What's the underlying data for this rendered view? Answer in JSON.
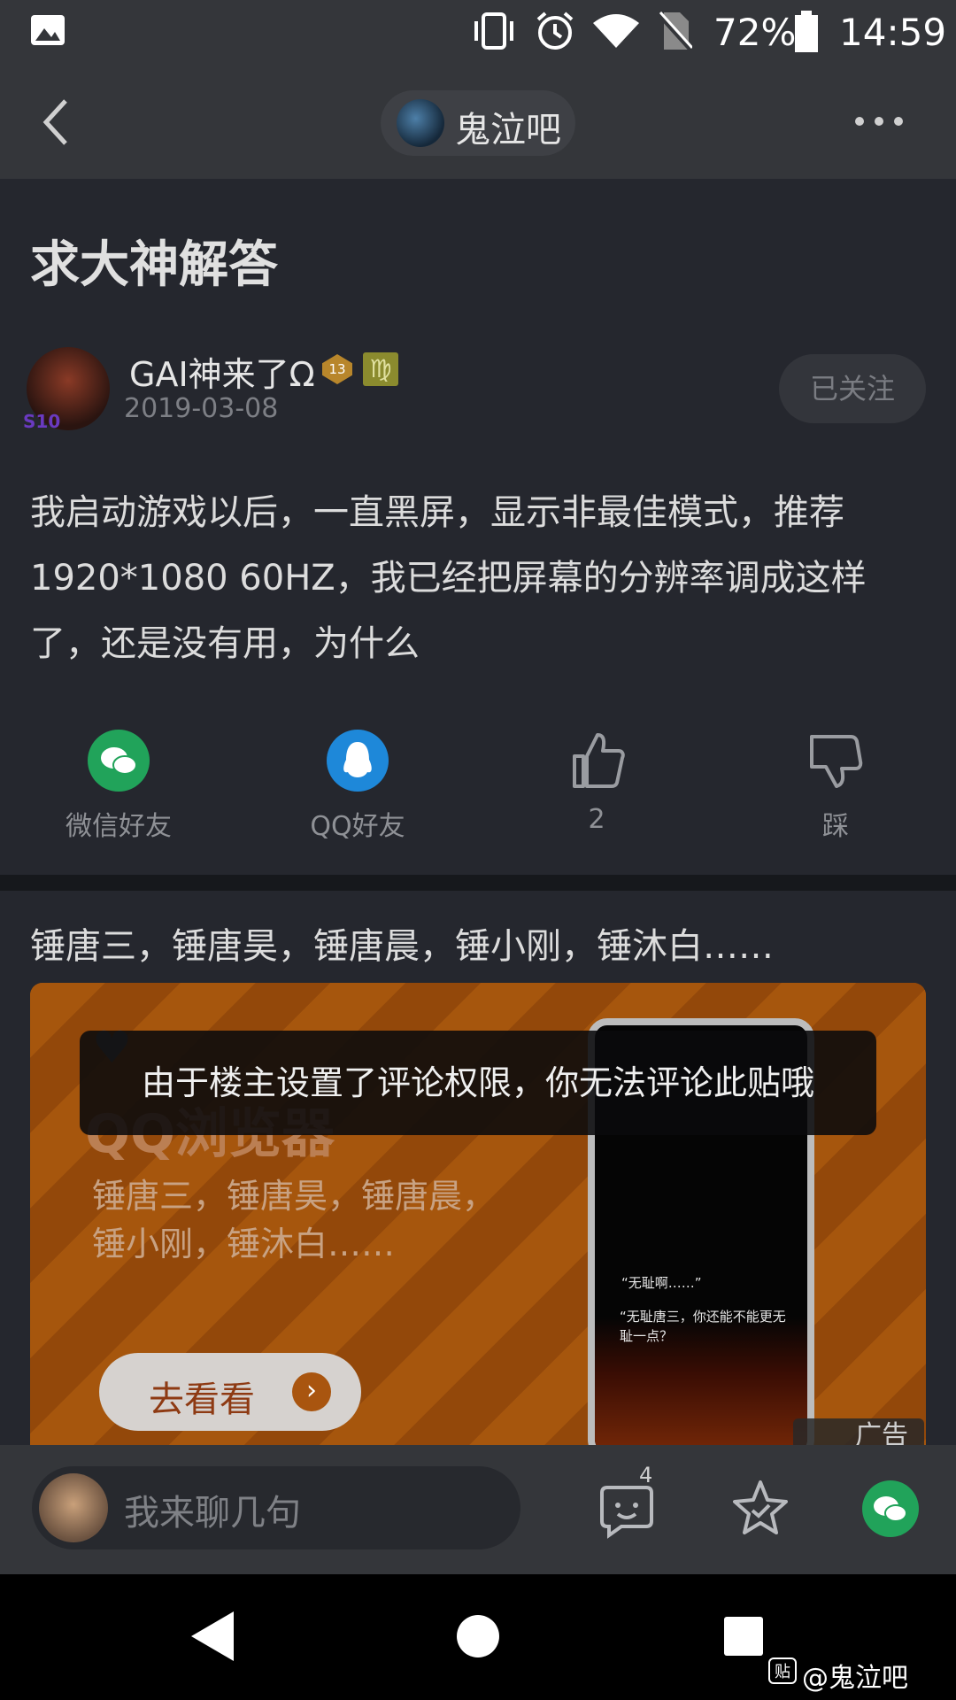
{
  "status_bar": {
    "battery": "72%",
    "time": "14:59"
  },
  "header": {
    "forum_name": "鬼泣吧"
  },
  "post": {
    "title": "求大神解答",
    "author": {
      "name": "GAI神来了Ω",
      "level": "13",
      "zodiac": "♍",
      "avatar_badge": "S10"
    },
    "date": "2019-03-08",
    "follow_label": "已关注",
    "content": "我启动游戏以后，一直黑屏，显示非最佳模式，推荐1920*1080 60HZ，我已经把屏幕的分辨率调成这样了，还是没有用，为什么"
  },
  "share": {
    "wechat": "微信好友",
    "qq": "QQ好友",
    "like_count": "2",
    "dislike": "踩"
  },
  "ad": {
    "text": "锤唐三，锤唐昊，锤唐晨，锤小刚，锤沐白……",
    "brand": "QQ浏览器",
    "sub1": "锤唐三，锤唐昊，锤唐晨，",
    "sub2": "锤小刚，锤沐白……",
    "button": "去看看",
    "phone_quote1": "“无耻啊……”",
    "phone_quote2": "“无耻唐三，你还能不能更无耻一点？",
    "tag": "广告"
  },
  "toast": "由于楼主设置了评论权限，你无法评论此贴哦",
  "bottom_bar": {
    "placeholder": "我来聊几句",
    "reply_count": "4"
  },
  "watermark": "@鬼泣吧",
  "colors": {
    "wechat": "#21a35a",
    "qq": "#1e88d9",
    "accent_orange": "#a9550f"
  }
}
